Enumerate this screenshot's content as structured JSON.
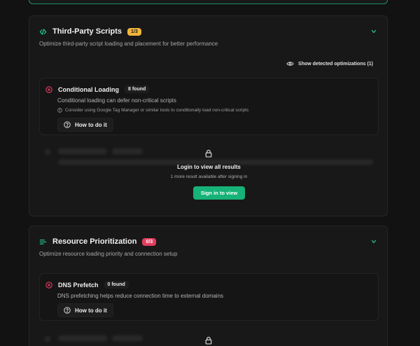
{
  "sections": [
    {
      "title": "Third-Party Scripts",
      "badge": "1/3",
      "description": "Optimize third-party script loading and placement for better performance",
      "detected_label": "Show detected optimizations (1)",
      "check": {
        "title": "Conditional Loading",
        "found": "8 found",
        "description": "Conditional loading can defer non-critical scripts",
        "tip": "Consider using Google Tag Manager or similar tools to conditionally load non-critical scripts",
        "howto": "How to do it"
      },
      "locked": {
        "title": "Login to view all results",
        "subtitle": "1 more result available after signing in",
        "button": "Sign in to view"
      }
    },
    {
      "title": "Resource Prioritization",
      "badge": "0/3",
      "description": "Optimize resource loading priority and connection setup",
      "check": {
        "title": "DNS Prefetch",
        "found": "0 found",
        "description": "DNS prefetching helps reduce connection time to external domains",
        "howto": "How to do it"
      }
    }
  ],
  "colors": {
    "accent_green": "#16b277",
    "badge_yellow": "#f1b53b",
    "badge_red": "#e23d5f",
    "fail_red": "#e23d5f"
  },
  "icons": {
    "code": "code-icon",
    "list": "list-icon",
    "chevron": "chevron-down-icon",
    "eye": "eye-icon",
    "fail": "x-circle-icon",
    "info": "info-icon",
    "help": "help-circle-icon",
    "lock": "lock-icon"
  }
}
